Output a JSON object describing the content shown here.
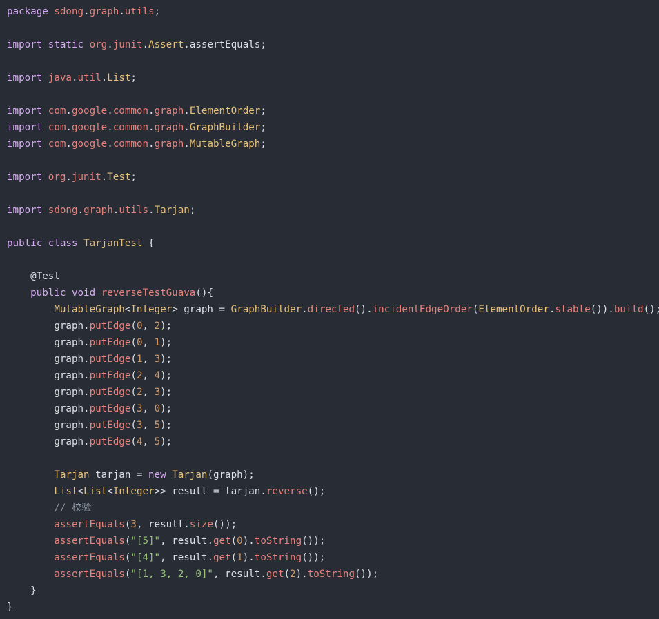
{
  "theme": {
    "background": "#282c34",
    "colors": {
      "keyword": "#d7a9f5",
      "package": "#e5827c",
      "class": "#e6c07b",
      "method": "#e5827c",
      "number": "#d49a66",
      "string": "#98c379",
      "comment": "#8b93a1",
      "plain": "#dcdfe4"
    }
  },
  "code": {
    "lines": [
      [
        [
          "kw",
          "package"
        ],
        [
          "t",
          " "
        ],
        [
          "pkg",
          "sdong"
        ],
        [
          "t",
          "."
        ],
        [
          "pkg",
          "graph"
        ],
        [
          "t",
          "."
        ],
        [
          "pkg",
          "utils"
        ],
        [
          "t",
          ";"
        ]
      ],
      [],
      [
        [
          "kw",
          "import"
        ],
        [
          "t",
          " "
        ],
        [
          "kw",
          "static"
        ],
        [
          "t",
          " "
        ],
        [
          "pkg",
          "org"
        ],
        [
          "t",
          "."
        ],
        [
          "pkg",
          "junit"
        ],
        [
          "t",
          "."
        ],
        [
          "cls",
          "Assert"
        ],
        [
          "t",
          "."
        ],
        [
          "t",
          "assertEquals"
        ],
        [
          "t",
          ";"
        ]
      ],
      [],
      [
        [
          "kw",
          "import"
        ],
        [
          "t",
          " "
        ],
        [
          "pkg",
          "java"
        ],
        [
          "t",
          "."
        ],
        [
          "pkg",
          "util"
        ],
        [
          "t",
          "."
        ],
        [
          "cls",
          "List"
        ],
        [
          "t",
          ";"
        ]
      ],
      [],
      [
        [
          "kw",
          "import"
        ],
        [
          "t",
          " "
        ],
        [
          "pkg",
          "com"
        ],
        [
          "t",
          "."
        ],
        [
          "pkg",
          "google"
        ],
        [
          "t",
          "."
        ],
        [
          "pkg",
          "common"
        ],
        [
          "t",
          "."
        ],
        [
          "pkg",
          "graph"
        ],
        [
          "t",
          "."
        ],
        [
          "cls",
          "ElementOrder"
        ],
        [
          "t",
          ";"
        ]
      ],
      [
        [
          "kw",
          "import"
        ],
        [
          "t",
          " "
        ],
        [
          "pkg",
          "com"
        ],
        [
          "t",
          "."
        ],
        [
          "pkg",
          "google"
        ],
        [
          "t",
          "."
        ],
        [
          "pkg",
          "common"
        ],
        [
          "t",
          "."
        ],
        [
          "pkg",
          "graph"
        ],
        [
          "t",
          "."
        ],
        [
          "cls",
          "GraphBuilder"
        ],
        [
          "t",
          ";"
        ]
      ],
      [
        [
          "kw",
          "import"
        ],
        [
          "t",
          " "
        ],
        [
          "pkg",
          "com"
        ],
        [
          "t",
          "."
        ],
        [
          "pkg",
          "google"
        ],
        [
          "t",
          "."
        ],
        [
          "pkg",
          "common"
        ],
        [
          "t",
          "."
        ],
        [
          "pkg",
          "graph"
        ],
        [
          "t",
          "."
        ],
        [
          "cls",
          "MutableGraph"
        ],
        [
          "t",
          ";"
        ]
      ],
      [],
      [
        [
          "kw",
          "import"
        ],
        [
          "t",
          " "
        ],
        [
          "pkg",
          "org"
        ],
        [
          "t",
          "."
        ],
        [
          "pkg",
          "junit"
        ],
        [
          "t",
          "."
        ],
        [
          "cls",
          "Test"
        ],
        [
          "t",
          ";"
        ]
      ],
      [],
      [
        [
          "kw",
          "import"
        ],
        [
          "t",
          " "
        ],
        [
          "pkg",
          "sdong"
        ],
        [
          "t",
          "."
        ],
        [
          "pkg",
          "graph"
        ],
        [
          "t",
          "."
        ],
        [
          "pkg",
          "utils"
        ],
        [
          "t",
          "."
        ],
        [
          "cls",
          "Tarjan"
        ],
        [
          "t",
          ";"
        ]
      ],
      [],
      [
        [
          "kw",
          "public"
        ],
        [
          "t",
          " "
        ],
        [
          "kw",
          "class"
        ],
        [
          "t",
          " "
        ],
        [
          "cls",
          "TarjanTest"
        ],
        [
          "t",
          " {"
        ]
      ],
      [],
      [
        [
          "t",
          "    "
        ],
        [
          "ann",
          "@Test"
        ]
      ],
      [
        [
          "t",
          "    "
        ],
        [
          "kw",
          "public"
        ],
        [
          "t",
          " "
        ],
        [
          "kw",
          "void"
        ],
        [
          "t",
          " "
        ],
        [
          "fn",
          "reverseTestGuava"
        ],
        [
          "t",
          "(){"
        ]
      ],
      [
        [
          "t",
          "        "
        ],
        [
          "cls",
          "MutableGraph"
        ],
        [
          "t",
          "<"
        ],
        [
          "cls",
          "Integer"
        ],
        [
          "t",
          "> graph = "
        ],
        [
          "cls",
          "GraphBuilder"
        ],
        [
          "t",
          "."
        ],
        [
          "fn",
          "directed"
        ],
        [
          "t",
          "()."
        ],
        [
          "fn",
          "incidentEdgeOrder"
        ],
        [
          "t",
          "("
        ],
        [
          "cls",
          "ElementOrder"
        ],
        [
          "t",
          "."
        ],
        [
          "fn",
          "stable"
        ],
        [
          "t",
          "())."
        ],
        [
          "fn",
          "build"
        ],
        [
          "t",
          "();"
        ]
      ],
      [
        [
          "t",
          "        graph."
        ],
        [
          "fn",
          "putEdge"
        ],
        [
          "t",
          "("
        ],
        [
          "num",
          "0"
        ],
        [
          "t",
          ", "
        ],
        [
          "num",
          "2"
        ],
        [
          "t",
          ");"
        ]
      ],
      [
        [
          "t",
          "        graph."
        ],
        [
          "fn",
          "putEdge"
        ],
        [
          "t",
          "("
        ],
        [
          "num",
          "0"
        ],
        [
          "t",
          ", "
        ],
        [
          "num",
          "1"
        ],
        [
          "t",
          ");"
        ]
      ],
      [
        [
          "t",
          "        graph."
        ],
        [
          "fn",
          "putEdge"
        ],
        [
          "t",
          "("
        ],
        [
          "num",
          "1"
        ],
        [
          "t",
          ", "
        ],
        [
          "num",
          "3"
        ],
        [
          "t",
          ");"
        ]
      ],
      [
        [
          "t",
          "        graph."
        ],
        [
          "fn",
          "putEdge"
        ],
        [
          "t",
          "("
        ],
        [
          "num",
          "2"
        ],
        [
          "t",
          ", "
        ],
        [
          "num",
          "4"
        ],
        [
          "t",
          ");"
        ]
      ],
      [
        [
          "t",
          "        graph."
        ],
        [
          "fn",
          "putEdge"
        ],
        [
          "t",
          "("
        ],
        [
          "num",
          "2"
        ],
        [
          "t",
          ", "
        ],
        [
          "num",
          "3"
        ],
        [
          "t",
          ");"
        ]
      ],
      [
        [
          "t",
          "        graph."
        ],
        [
          "fn",
          "putEdge"
        ],
        [
          "t",
          "("
        ],
        [
          "num",
          "3"
        ],
        [
          "t",
          ", "
        ],
        [
          "num",
          "0"
        ],
        [
          "t",
          ");"
        ]
      ],
      [
        [
          "t",
          "        graph."
        ],
        [
          "fn",
          "putEdge"
        ],
        [
          "t",
          "("
        ],
        [
          "num",
          "3"
        ],
        [
          "t",
          ", "
        ],
        [
          "num",
          "5"
        ],
        [
          "t",
          ");"
        ]
      ],
      [
        [
          "t",
          "        graph."
        ],
        [
          "fn",
          "putEdge"
        ],
        [
          "t",
          "("
        ],
        [
          "num",
          "4"
        ],
        [
          "t",
          ", "
        ],
        [
          "num",
          "5"
        ],
        [
          "t",
          ");"
        ]
      ],
      [],
      [
        [
          "t",
          "        "
        ],
        [
          "cls",
          "Tarjan"
        ],
        [
          "t",
          " tarjan = "
        ],
        [
          "kw",
          "new"
        ],
        [
          "t",
          " "
        ],
        [
          "cls",
          "Tarjan"
        ],
        [
          "t",
          "(graph);"
        ]
      ],
      [
        [
          "t",
          "        "
        ],
        [
          "cls",
          "List"
        ],
        [
          "t",
          "<"
        ],
        [
          "cls",
          "List"
        ],
        [
          "t",
          "<"
        ],
        [
          "cls",
          "Integer"
        ],
        [
          "t",
          ">> result = tarjan."
        ],
        [
          "fn",
          "reverse"
        ],
        [
          "t",
          "();"
        ]
      ],
      [
        [
          "t",
          "        "
        ],
        [
          "cmt",
          "// 校验"
        ]
      ],
      [
        [
          "t",
          "        "
        ],
        [
          "fn",
          "assertEquals"
        ],
        [
          "t",
          "("
        ],
        [
          "num",
          "3"
        ],
        [
          "t",
          ", result."
        ],
        [
          "fn",
          "size"
        ],
        [
          "t",
          "());"
        ]
      ],
      [
        [
          "t",
          "        "
        ],
        [
          "fn",
          "assertEquals"
        ],
        [
          "t",
          "("
        ],
        [
          "str",
          "\"[5]\""
        ],
        [
          "t",
          ", result."
        ],
        [
          "fn",
          "get"
        ],
        [
          "t",
          "("
        ],
        [
          "num",
          "0"
        ],
        [
          "t",
          ")."
        ],
        [
          "fn",
          "toString"
        ],
        [
          "t",
          "());"
        ]
      ],
      [
        [
          "t",
          "        "
        ],
        [
          "fn",
          "assertEquals"
        ],
        [
          "t",
          "("
        ],
        [
          "str",
          "\"[4]\""
        ],
        [
          "t",
          ", result."
        ],
        [
          "fn",
          "get"
        ],
        [
          "t",
          "("
        ],
        [
          "num",
          "1"
        ],
        [
          "t",
          ")."
        ],
        [
          "fn",
          "toString"
        ],
        [
          "t",
          "());"
        ]
      ],
      [
        [
          "t",
          "        "
        ],
        [
          "fn",
          "assertEquals"
        ],
        [
          "t",
          "("
        ],
        [
          "str",
          "\"[1, 3, 2, 0]\""
        ],
        [
          "t",
          ", result."
        ],
        [
          "fn",
          "get"
        ],
        [
          "t",
          "("
        ],
        [
          "num",
          "2"
        ],
        [
          "t",
          ")."
        ],
        [
          "fn",
          "toString"
        ],
        [
          "t",
          "());"
        ]
      ],
      [
        [
          "t",
          "    }"
        ]
      ],
      [
        [
          "t",
          "}"
        ]
      ]
    ]
  }
}
